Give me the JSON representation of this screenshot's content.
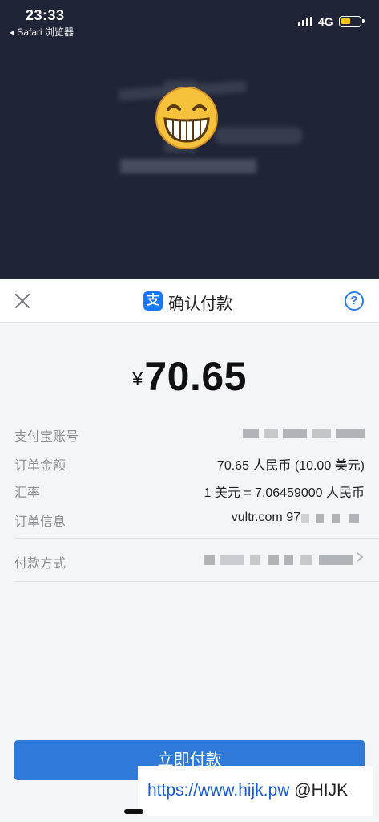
{
  "status_bar": {
    "time": "23:33",
    "back_app": "◂ Safari 浏览器",
    "network": "4G"
  },
  "sheet": {
    "title": "确认付款",
    "currency_symbol": "¥",
    "amount": "70.65",
    "rows": [
      {
        "key": "支付宝账号",
        "value": ""
      },
      {
        "key": "订单金额",
        "value": "70.65 人民币 (10.00 美元)"
      },
      {
        "key": "汇率",
        "value": "1 美元 = 7.06459000 人民币"
      },
      {
        "key": "订单信息",
        "value": "vultr.com 97"
      }
    ],
    "payment_method_label": "付款方式",
    "pay_button": "立即付款"
  },
  "watermark": {
    "url": "https://www.hijk.pw",
    "handle": "@HIJK"
  },
  "colors": {
    "accent": "#2f7ad8",
    "alipay": "#1677ff",
    "battery": "#f5c518",
    "dark_bg": "#1f2536"
  },
  "icons": [
    "close-icon",
    "alipay-icon",
    "help-icon",
    "chevron-right-icon",
    "emoji-grin-icon"
  ]
}
